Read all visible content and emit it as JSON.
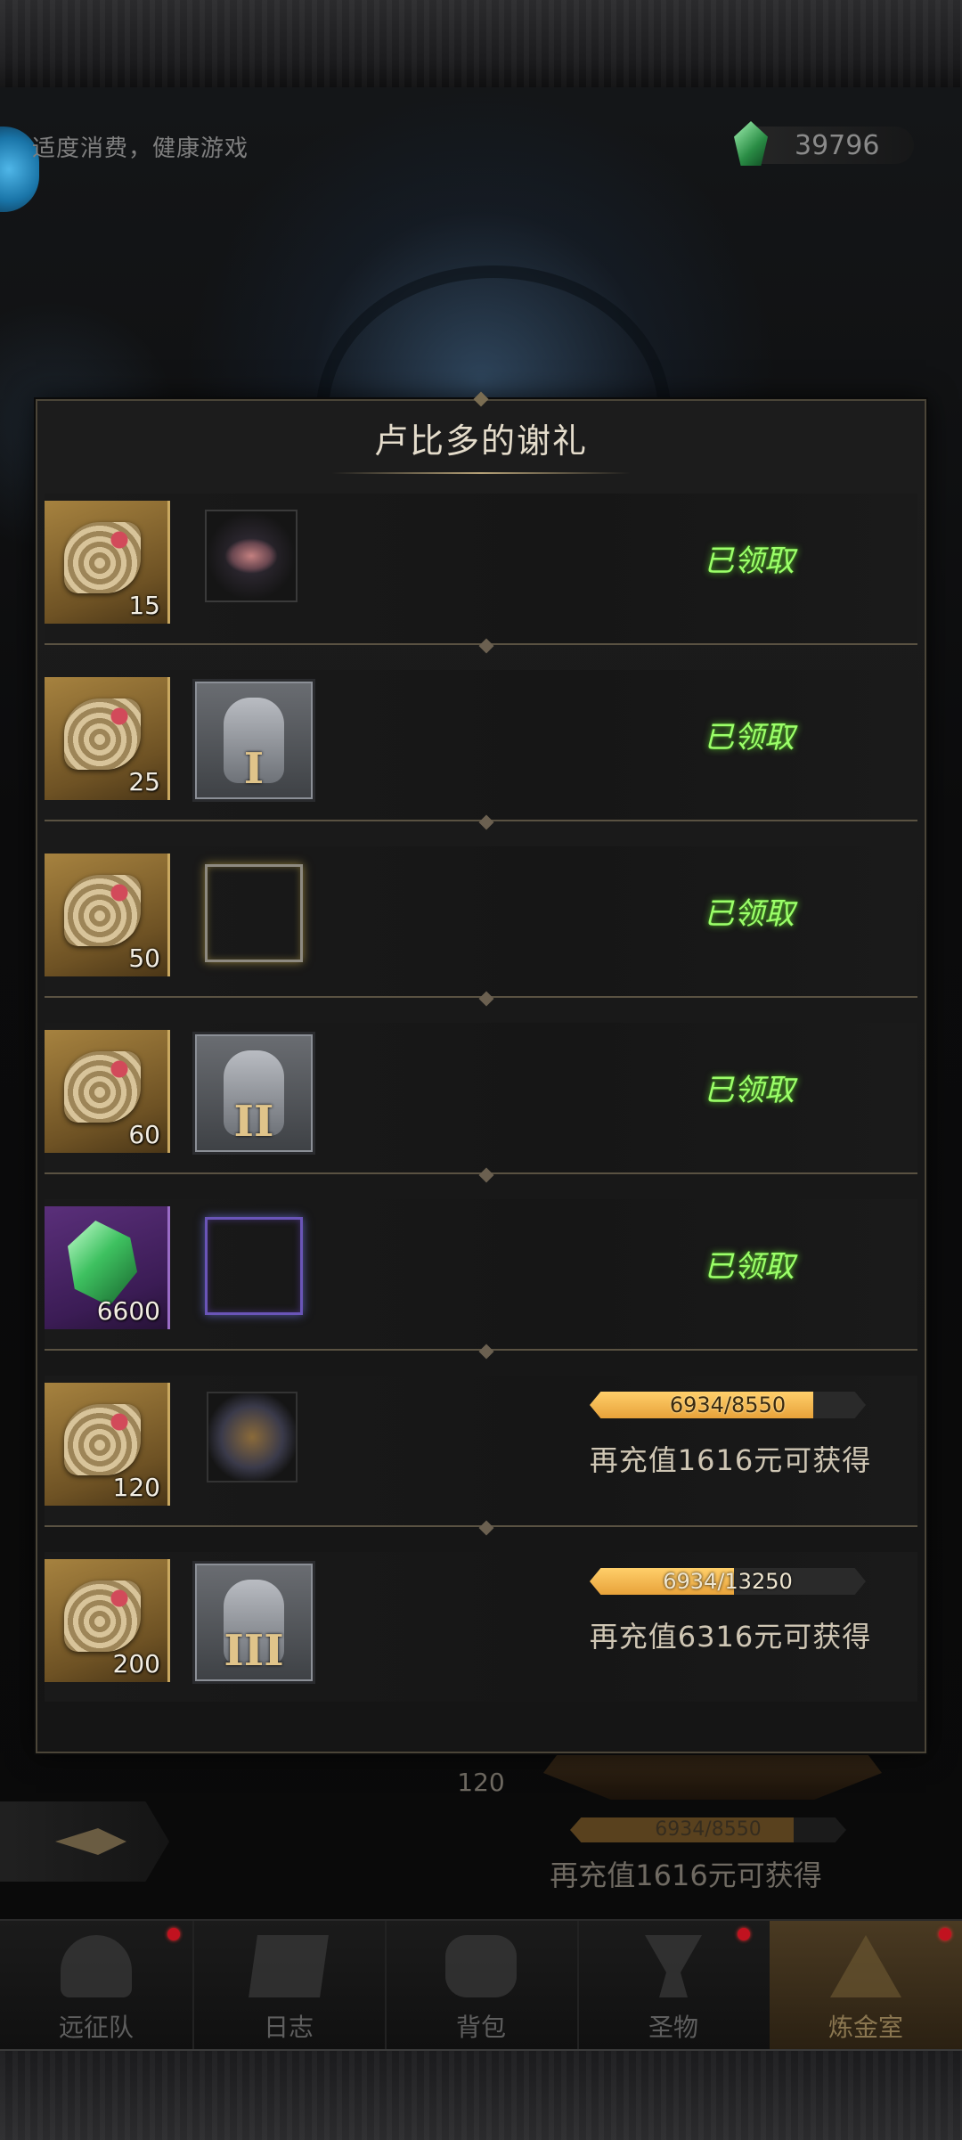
{
  "header": {
    "notice": "适度消费，健康游戏",
    "currency_value": "39796"
  },
  "modal": {
    "title": "卢比多的谢礼",
    "rows": [
      {
        "item_type": "scroll",
        "count": "15",
        "reward_icon": "skull-artifact-icon",
        "status": "已领取"
      },
      {
        "item_type": "scroll",
        "count": "25",
        "reward_icon": "armor-tier-1-icon",
        "numeral": "I",
        "status": "已领取"
      },
      {
        "item_type": "scroll",
        "count": "50",
        "reward_icon": "golden-frame-icon",
        "status": "已领取"
      },
      {
        "item_type": "scroll",
        "count": "60",
        "reward_icon": "armor-tier-2-icon",
        "numeral": "II",
        "status": "已领取"
      },
      {
        "item_type": "crystal",
        "count": "6600",
        "reward_icon": "purple-frame-icon",
        "status": "已领取"
      },
      {
        "item_type": "scroll",
        "count": "120",
        "reward_icon": "mechanical-relic-icon",
        "progress_current": 6934,
        "progress_total": 8550,
        "progress_text": "6934/8550",
        "progress_fraction": 0.811,
        "recharge_text": "再充值1616元可获得"
      },
      {
        "item_type": "scroll",
        "count": "200",
        "reward_icon": "armor-tier-3-icon",
        "numeral": "III",
        "progress_current": 6934,
        "progress_total": 13250,
        "progress_text": "6934/13250",
        "progress_fraction": 0.523,
        "recharge_text": "再充值6316元可获得"
      }
    ]
  },
  "behind": {
    "count": "120",
    "progress_text": "6934/8550",
    "progress_fraction": 0.811,
    "recharge_text": "再充值1616元可获得"
  },
  "nav": {
    "items": [
      {
        "label": "远征队",
        "icon": "viking-helmet-icon",
        "badge": true
      },
      {
        "label": "日志",
        "icon": "map-scroll-icon",
        "badge": false
      },
      {
        "label": "背包",
        "icon": "backpack-icon",
        "badge": false
      },
      {
        "label": "圣物",
        "icon": "chalice-icon",
        "badge": true
      },
      {
        "label": "炼金室",
        "icon": "alchemy-icon",
        "badge": true,
        "active": true
      }
    ]
  },
  "colors": {
    "claimed_green": "#9cff6a",
    "progress_gold": "#e8a23a",
    "badge_red": "#c1121f"
  }
}
